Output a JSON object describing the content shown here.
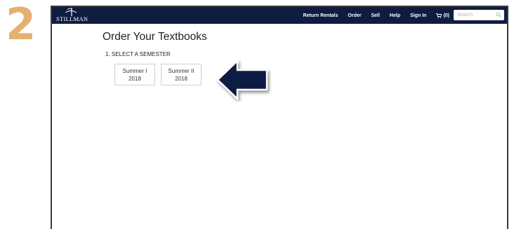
{
  "step": {
    "number": "2"
  },
  "colors": {
    "step_accent": "#e4b170",
    "navbar": "#0f1c42",
    "arrow_fill": "#0f1c42"
  },
  "header": {
    "logo_text": "STILLMAN",
    "nav": [
      {
        "label": "Return Rentals"
      },
      {
        "label": "Order"
      },
      {
        "label": "Sell"
      },
      {
        "label": "Help"
      },
      {
        "label": "Sign In"
      }
    ],
    "cart_label": "(0)",
    "search": {
      "placeholder": "Search"
    }
  },
  "main": {
    "title": "Order Your Textbooks",
    "section_heading": "1. SELECT A SEMESTER",
    "semesters": [
      {
        "name": "Summer I",
        "year": "2018"
      },
      {
        "name": "Summer II",
        "year": "2018"
      }
    ]
  },
  "icons": {
    "cart": "cart-icon",
    "search": "search-icon",
    "logo": "stillman-logo-icon",
    "arrow": "left-arrow-icon"
  }
}
